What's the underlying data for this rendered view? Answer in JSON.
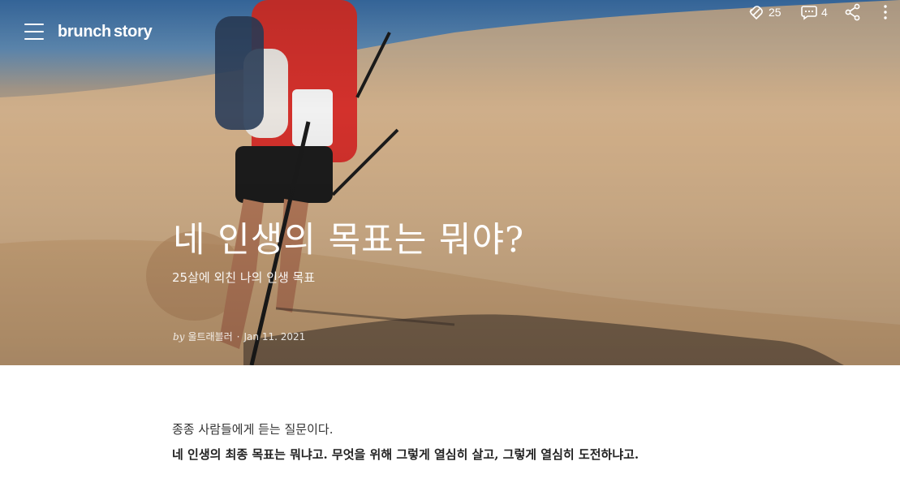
{
  "app": {
    "logo_text_1": "brunch",
    "logo_text_2": "story"
  },
  "header": {
    "menu_icon": "hamburger-menu-icon",
    "like_icon": "like-icon",
    "like_count": "25",
    "comment_icon": "comment-icon",
    "comment_count": "4",
    "share_icon": "share-icon",
    "more_icon": "more-vertical-icon"
  },
  "article": {
    "title": "네 인생의 목표는 뭐야?",
    "subtitle": "25살에 외친 나의 인생 목표",
    "by_label": "by",
    "author": "울트래블러",
    "date": "Jan 11. 2021",
    "paragraphs": [
      "종종 사람들에게 듣는 질문이다.",
      "네 인생의 최종 목표는 뭐냐고. 무엇을 위해 그렇게 열심히 살고, 그렇게 열심히 도전하냐고."
    ]
  },
  "colors": {
    "overlay_text": "#ffffff",
    "body_text": "#333333"
  }
}
